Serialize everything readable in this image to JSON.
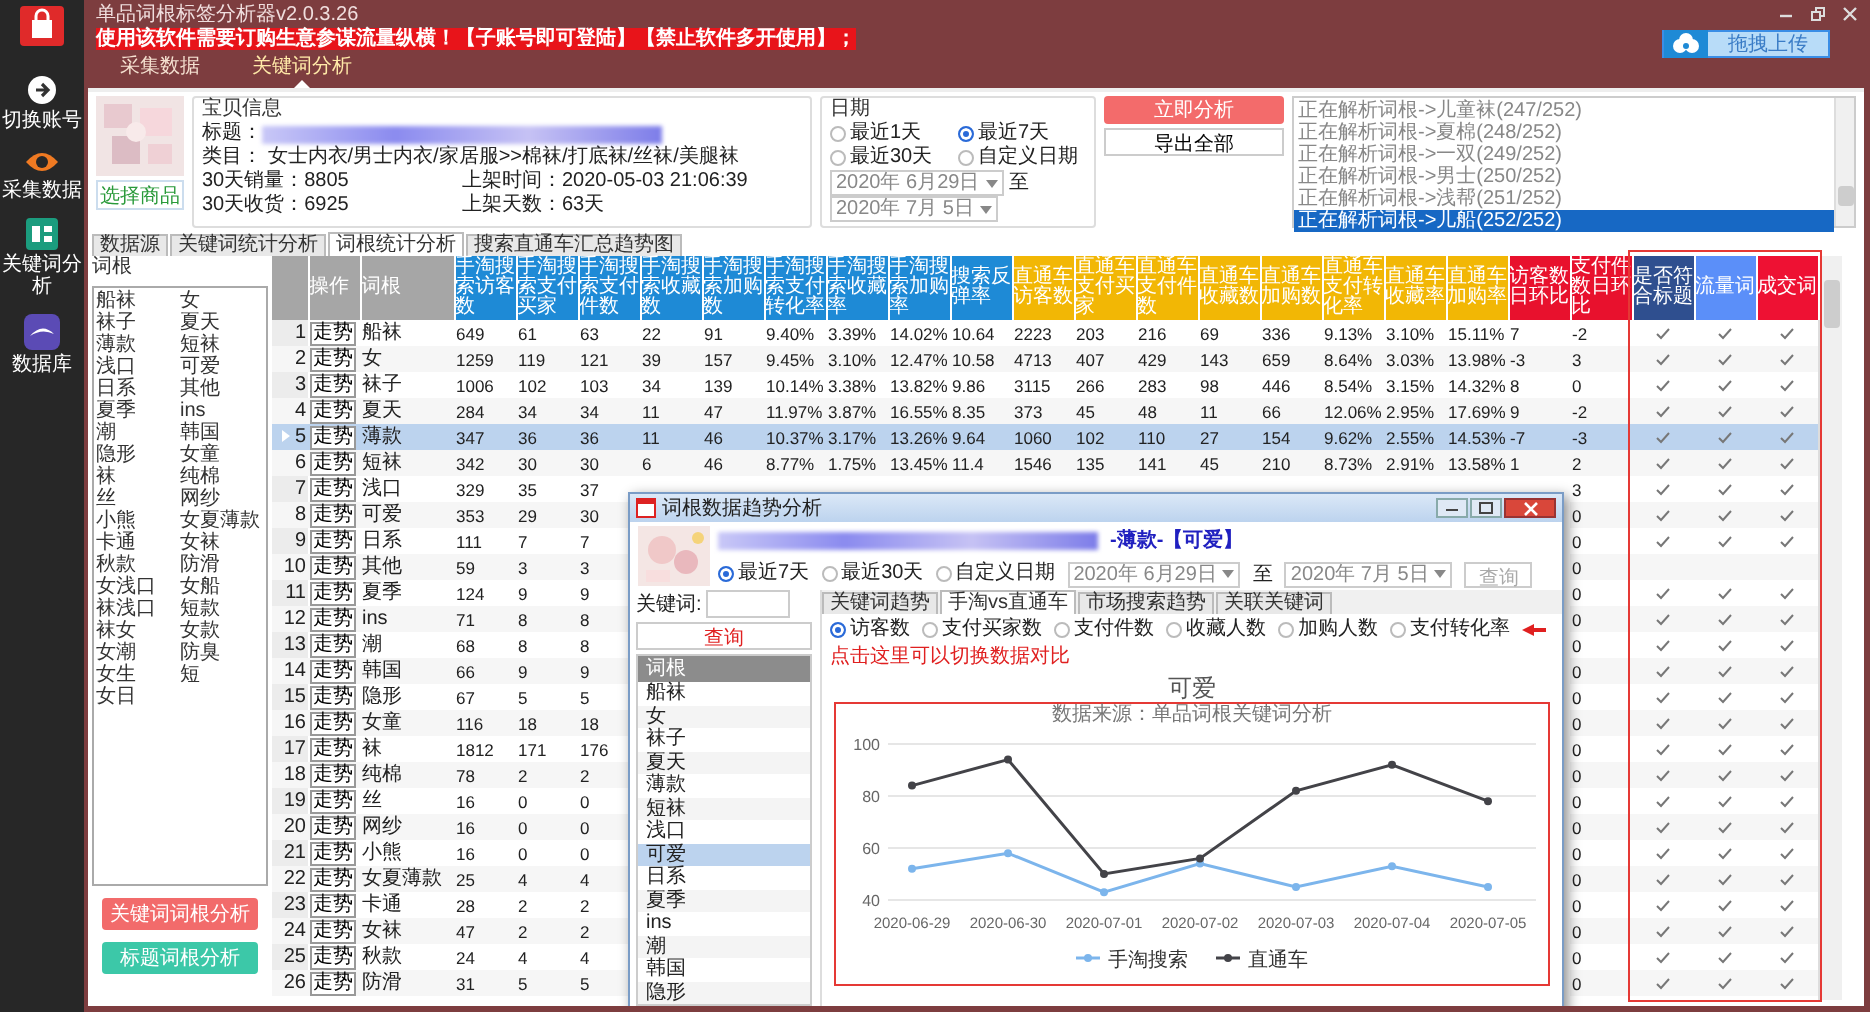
{
  "sidebar": {
    "items": [
      {
        "label": "切换账号",
        "kind": "account"
      },
      {
        "label": "采集数据",
        "kind": "eye"
      },
      {
        "label": "关键词分析",
        "kind": "chart"
      },
      {
        "label": "数据库",
        "kind": "database"
      }
    ]
  },
  "app": {
    "title": "单品词根标签分析器v2.0.3.26",
    "notice": "使用该软件需要订购生意参谋流量纵横！【子账号即可登陆】【禁止软件多开使用】；",
    "tabs": [
      {
        "label": "采集数据",
        "selected": false
      },
      {
        "label": "关键词分析",
        "selected": true
      }
    ],
    "upload_button": "拖拽上传"
  },
  "product": {
    "select_button": "选择商品",
    "group_title": "宝贝信息",
    "title_label": "标题：",
    "category": "类目：  女士内衣/男士内衣/家居服>>棉袜/打底袜/丝袜/美腿袜",
    "sales": "30天销量：8805",
    "received": "30天收货：6925",
    "listed": "上架时间：2020-05-03 21:06:39",
    "days": "上架天数：63天"
  },
  "date_filter": {
    "title": "日期",
    "options": [
      {
        "label": "最近1天",
        "selected": false
      },
      {
        "label": "最近7天",
        "selected": true
      },
      {
        "label": "最近30天",
        "selected": false
      },
      {
        "label": "自定义日期",
        "selected": false
      }
    ],
    "from": "2020年 6月29日",
    "separator": "至",
    "to": "2020年 7月 5日"
  },
  "actions": {
    "analyze": "立即分析",
    "export": "导出全部"
  },
  "log": [
    {
      "text": "正在解析词根->儿童袜(247/252)",
      "selected": false
    },
    {
      "text": "正在解析词根->夏棉(248/252)",
      "selected": false
    },
    {
      "text": "正在解析词根->一双(249/252)",
      "selected": false
    },
    {
      "text": "正在解析词根->男士(250/252)",
      "selected": false
    },
    {
      "text": "正在解析词根->浅帮(251/252)",
      "selected": false
    },
    {
      "text": "正在解析词根->儿船(252/252)",
      "selected": true
    }
  ],
  "subtabs": [
    {
      "label": "数据源",
      "selected": false
    },
    {
      "label": "关键词统计分析",
      "selected": false
    },
    {
      "label": "词根统计分析",
      "selected": true
    },
    {
      "label": "搜索直通车汇总趋势图",
      "selected": false
    }
  ],
  "roots": {
    "title": "词根",
    "items": [
      "船袜",
      "女",
      "袜子",
      "夏天",
      "薄款",
      "短袜",
      "浅口",
      "可爱",
      "日系",
      "其他",
      "夏季",
      "ins",
      "潮",
      "韩国",
      "隐形",
      "女童",
      "袜",
      "纯棉",
      "丝",
      "网纱",
      "小熊",
      "女夏薄款",
      "卡通",
      "女袜",
      "秋款",
      "防滑",
      "女浅口",
      "女船",
      "袜浅口",
      "短款",
      "袜女",
      "女款",
      "女潮",
      "防臭",
      "女生",
      "短",
      "女日"
    ],
    "buttons": [
      {
        "label": "关键词词根分析",
        "color": "#f26b6b"
      },
      {
        "label": "标题词根分析",
        "color": "#3cc8a8"
      }
    ]
  },
  "table": {
    "columns": [
      {
        "label": "操作",
        "color": "#a6a6a6"
      },
      {
        "label": "词根",
        "color": "#a6a6a6"
      },
      {
        "label": "手淘搜索访客数",
        "color": "#1e8ad6"
      },
      {
        "label": "手淘搜索支付买家",
        "color": "#1e8ad6"
      },
      {
        "label": "手淘搜索支付件数",
        "color": "#1e8ad6"
      },
      {
        "label": "手淘搜索收藏数",
        "color": "#1e8ad6"
      },
      {
        "label": "手淘搜索加购数",
        "color": "#1e8ad6"
      },
      {
        "label": "手淘搜索支付转化率",
        "color": "#1e8ad6"
      },
      {
        "label": "手淘搜索收藏率",
        "color": "#1e8ad6"
      },
      {
        "label": "手淘搜索加购率",
        "color": "#1e8ad6"
      },
      {
        "label": "搜索反弹率",
        "color": "#1e8ad6"
      },
      {
        "label": "直通车访客数",
        "color": "#f2b705"
      },
      {
        "label": "直通车支付买家",
        "color": "#f2b705"
      },
      {
        "label": "直通车支付件数",
        "color": "#f2b705"
      },
      {
        "label": "直通车收藏数",
        "color": "#f2b705"
      },
      {
        "label": "直通车加购数",
        "color": "#f2b705"
      },
      {
        "label": "直通车支付转化率",
        "color": "#f2b705"
      },
      {
        "label": "直通车收藏率",
        "color": "#f2b705"
      },
      {
        "label": "直通车加购率",
        "color": "#f2b705"
      },
      {
        "label": "访客数日环比",
        "color": "#e8112d"
      },
      {
        "label": "支付件数日环比",
        "color": "#e8112d"
      },
      {
        "label": "是否符合标题",
        "color": "#2f4f8f"
      },
      {
        "label": "流量词",
        "color": "#5b8ff9"
      },
      {
        "label": "成交词",
        "color": "#ee1133"
      }
    ],
    "rows": [
      {
        "index": "1",
        "action": "走势",
        "root": "船袜",
        "selected": false,
        "values": [
          "649",
          "61",
          "63",
          "22",
          "91",
          "9.40%",
          "3.39%",
          "14.02%",
          "10.64",
          "2223",
          "203",
          "216",
          "69",
          "336",
          "9.13%",
          "3.10%",
          "15.11%",
          "7",
          "-2"
        ],
        "checks": [
          {
            "checked": true
          },
          {
            "checked": true
          },
          {
            "checked": true
          }
        ]
      },
      {
        "index": "2",
        "action": "走势",
        "root": "女",
        "selected": false,
        "values": [
          "1259",
          "119",
          "121",
          "39",
          "157",
          "9.45%",
          "3.10%",
          "12.47%",
          "10.58",
          "4713",
          "407",
          "429",
          "143",
          "659",
          "8.64%",
          "3.03%",
          "13.98%",
          "-3",
          "3"
        ],
        "checks": [
          {
            "checked": true
          },
          {
            "checked": true
          },
          {
            "checked": true
          }
        ]
      },
      {
        "index": "3",
        "action": "走势",
        "root": "袜子",
        "selected": false,
        "values": [
          "1006",
          "102",
          "103",
          "34",
          "139",
          "10.14%",
          "3.38%",
          "13.82%",
          "9.86",
          "3115",
          "266",
          "283",
          "98",
          "446",
          "8.54%",
          "3.15%",
          "14.32%",
          "8",
          "0"
        ],
        "checks": [
          {
            "checked": true
          },
          {
            "checked": true
          },
          {
            "checked": true
          }
        ]
      },
      {
        "index": "4",
        "action": "走势",
        "root": "夏天",
        "selected": false,
        "values": [
          "284",
          "34",
          "34",
          "11",
          "47",
          "11.97%",
          "3.87%",
          "16.55%",
          "8.35",
          "373",
          "45",
          "48",
          "11",
          "66",
          "12.06%",
          "2.95%",
          "17.69%",
          "9",
          "-2"
        ],
        "checks": [
          {
            "checked": true
          },
          {
            "checked": true
          },
          {
            "checked": true
          }
        ]
      },
      {
        "index": "5",
        "action": "走势",
        "root": "薄款",
        "selected": true,
        "values": [
          "347",
          "36",
          "36",
          "11",
          "46",
          "10.37%",
          "3.17%",
          "13.26%",
          "9.64",
          "1060",
          "102",
          "110",
          "27",
          "154",
          "9.62%",
          "2.55%",
          "14.53%",
          "-7",
          "-3"
        ],
        "checks": [
          {
            "checked": true
          },
          {
            "checked": true
          },
          {
            "checked": true
          }
        ]
      },
      {
        "index": "6",
        "action": "走势",
        "root": "短袜",
        "selected": false,
        "values": [
          "342",
          "30",
          "30",
          "6",
          "46",
          "8.77%",
          "1.75%",
          "13.45%",
          "11.4",
          "1546",
          "135",
          "141",
          "45",
          "210",
          "8.73%",
          "2.91%",
          "13.58%",
          "1",
          "2"
        ],
        "checks": [
          {
            "checked": true
          },
          {
            "checked": true
          },
          {
            "checked": true
          }
        ]
      },
      {
        "index": "7",
        "action": "走势",
        "root": "浅口",
        "selected": false,
        "values": [
          "329",
          "35",
          "37"
        ],
        "last_value": "3",
        "checks": [
          {
            "checked": true
          },
          {
            "checked": true
          },
          {
            "checked": true
          }
        ]
      },
      {
        "index": "8",
        "action": "走势",
        "root": "可爱",
        "selected": false,
        "values": [
          "353",
          "29",
          "30"
        ],
        "last_value": "0",
        "checks": [
          {
            "checked": true
          },
          {
            "checked": true
          },
          {
            "checked": true
          }
        ]
      },
      {
        "index": "9",
        "action": "走势",
        "root": "日系",
        "selected": false,
        "values": [
          "111",
          "7",
          "7"
        ],
        "last_value": "0",
        "checks": [
          {
            "checked": true
          },
          {
            "checked": true
          },
          {
            "checked": true
          }
        ]
      },
      {
        "index": "10",
        "action": "走势",
        "root": "其他",
        "selected": false,
        "values": [
          "59",
          "3",
          "3"
        ],
        "last_value": "0",
        "checks": [
          {
            "checked": false
          },
          {
            "checked": false
          },
          {
            "checked": false
          }
        ]
      },
      {
        "index": "11",
        "action": "走势",
        "root": "夏季",
        "selected": false,
        "values": [
          "124",
          "9",
          "9"
        ],
        "last_value": "0",
        "checks": [
          {
            "checked": true
          },
          {
            "checked": true
          },
          {
            "checked": true
          }
        ]
      },
      {
        "index": "12",
        "action": "走势",
        "root": "ins",
        "selected": false,
        "values": [
          "71",
          "8",
          "8"
        ],
        "last_value": "0",
        "checks": [
          {
            "checked": true
          },
          {
            "checked": true
          },
          {
            "checked": true
          }
        ]
      },
      {
        "index": "13",
        "action": "走势",
        "root": "潮",
        "selected": false,
        "values": [
          "68",
          "8",
          "8"
        ],
        "last_value": "0",
        "checks": [
          {
            "checked": true
          },
          {
            "checked": true
          },
          {
            "checked": true
          }
        ]
      },
      {
        "index": "14",
        "action": "走势",
        "root": "韩国",
        "selected": false,
        "values": [
          "66",
          "9",
          "9"
        ],
        "last_value": "0",
        "checks": [
          {
            "checked": true
          },
          {
            "checked": true
          },
          {
            "checked": true
          }
        ]
      },
      {
        "index": "15",
        "action": "走势",
        "root": "隐形",
        "selected": false,
        "values": [
          "67",
          "5",
          "5"
        ],
        "last_value": "0",
        "checks": [
          {
            "checked": true
          },
          {
            "checked": true
          },
          {
            "checked": true
          }
        ]
      },
      {
        "index": "16",
        "action": "走势",
        "root": "女童",
        "selected": false,
        "values": [
          "116",
          "18",
          "18"
        ],
        "last_value": "0",
        "checks": [
          {
            "checked": true
          },
          {
            "checked": true
          },
          {
            "checked": true
          }
        ]
      },
      {
        "index": "17",
        "action": "走势",
        "root": "袜",
        "selected": false,
        "values": [
          "1812",
          "171",
          "176"
        ],
        "last_value": "0",
        "checks": [
          {
            "checked": true
          },
          {
            "checked": true
          },
          {
            "checked": true
          }
        ]
      },
      {
        "index": "18",
        "action": "走势",
        "root": "纯棉",
        "selected": false,
        "values": [
          "78",
          "2",
          "2"
        ],
        "last_value": "0",
        "checks": [
          {
            "checked": true
          },
          {
            "checked": true
          },
          {
            "checked": true
          }
        ]
      },
      {
        "index": "19",
        "action": "走势",
        "root": "丝",
        "selected": false,
        "values": [
          "16",
          "0",
          "0"
        ],
        "last_value": "0",
        "checks": [
          {
            "checked": true
          },
          {
            "checked": true
          },
          {
            "checked": true
          }
        ]
      },
      {
        "index": "20",
        "action": "走势",
        "root": "网纱",
        "selected": false,
        "values": [
          "16",
          "0",
          "0"
        ],
        "last_value": "0",
        "checks": [
          {
            "checked": true
          },
          {
            "checked": true
          },
          {
            "checked": true
          }
        ]
      },
      {
        "index": "21",
        "action": "走势",
        "root": "小熊",
        "selected": false,
        "values": [
          "16",
          "0",
          "0"
        ],
        "last_value": "0",
        "checks": [
          {
            "checked": true
          },
          {
            "checked": true
          },
          {
            "checked": true
          }
        ]
      },
      {
        "index": "22",
        "action": "走势",
        "root": "女夏薄款",
        "selected": false,
        "values": [
          "25",
          "4",
          "4"
        ],
        "last_value": "0",
        "checks": [
          {
            "checked": true
          },
          {
            "checked": true
          },
          {
            "checked": true
          }
        ]
      },
      {
        "index": "23",
        "action": "走势",
        "root": "卡通",
        "selected": false,
        "values": [
          "28",
          "2",
          "2"
        ],
        "last_value": "0",
        "checks": [
          {
            "checked": true
          },
          {
            "checked": true
          },
          {
            "checked": true
          }
        ]
      },
      {
        "index": "24",
        "action": "走势",
        "root": "女袜",
        "selected": false,
        "values": [
          "47",
          "2",
          "2"
        ],
        "last_value": "0",
        "checks": [
          {
            "checked": true
          },
          {
            "checked": true
          },
          {
            "checked": true
          }
        ]
      },
      {
        "index": "25",
        "action": "走势",
        "root": "秋款",
        "selected": false,
        "values": [
          "24",
          "4",
          "4"
        ],
        "last_value": "0",
        "checks": [
          {
            "checked": true
          },
          {
            "checked": true
          },
          {
            "checked": true
          }
        ]
      },
      {
        "index": "26",
        "action": "走势",
        "root": "防滑",
        "selected": false,
        "values": [
          "31",
          "5",
          "5"
        ],
        "last_value": "0",
        "checks": [
          {
            "checked": true
          },
          {
            "checked": true
          },
          {
            "checked": true
          }
        ]
      }
    ]
  },
  "dialog": {
    "title": "词根数据趋势分析",
    "heading": "-薄款-【可爱】",
    "ranges": [
      {
        "label": "最近7天",
        "selected": true
      },
      {
        "label": "最近30天",
        "selected": false
      },
      {
        "label": "自定义日期",
        "selected": false
      }
    ],
    "from": "2020年 6月29日",
    "separator": "至",
    "to": "2020年 7月 5日",
    "query_button": {
      "label": "查询",
      "disabled": true
    },
    "keyword_label": "关键词:",
    "search_button": "查询",
    "list_header": "词根",
    "list": [
      {
        "label": "船袜",
        "selected": false
      },
      {
        "label": "女",
        "selected": false
      },
      {
        "label": "袜子",
        "selected": false
      },
      {
        "label": "夏天",
        "selected": false
      },
      {
        "label": "薄款",
        "selected": false
      },
      {
        "label": "短袜",
        "selected": false
      },
      {
        "label": "浅口",
        "selected": false
      },
      {
        "label": "可爱",
        "selected": true
      },
      {
        "label": "日系",
        "selected": false
      },
      {
        "label": "夏季",
        "selected": false
      },
      {
        "label": "ins",
        "selected": false
      },
      {
        "label": "潮",
        "selected": false
      },
      {
        "label": "韩国",
        "selected": false
      },
      {
        "label": "隐形",
        "selected": false
      }
    ],
    "tabs": [
      {
        "label": "关键词趋势",
        "selected": false
      },
      {
        "label": "手淘vs直通车",
        "selected": true
      },
      {
        "label": "市场搜索趋势",
        "selected": false
      },
      {
        "label": "关联关键词",
        "selected": false
      }
    ],
    "metrics": [
      {
        "label": "访客数",
        "selected": true
      },
      {
        "label": "支付买家数",
        "selected": false
      },
      {
        "label": "支付件数",
        "selected": false
      },
      {
        "label": "收藏人数",
        "selected": false
      },
      {
        "label": "加购人数",
        "selected": false
      },
      {
        "label": "支付转化率",
        "selected": false
      }
    ],
    "hint": "点击这里可以切换数据对比",
    "chart_subtitle": "数据来源：单品词根关键词分析",
    "chart_data": {
      "type": "line",
      "title": "可爱",
      "categories": [
        "2020-06-29",
        "2020-06-30",
        "2020-07-01",
        "2020-07-02",
        "2020-07-03",
        "2020-07-04",
        "2020-07-05"
      ],
      "series": [
        {
          "name": "手淘搜索",
          "color": "#7cb5ec",
          "marker": "circle",
          "values": [
            52,
            58,
            43,
            54,
            45,
            53,
            45
          ]
        },
        {
          "name": "直通车",
          "color": "#434348",
          "marker": "circle",
          "values": [
            84,
            94,
            50,
            56,
            82,
            92,
            78
          ]
        }
      ],
      "ylim": [
        40,
        100
      ],
      "yticks": [
        40,
        60,
        80,
        100
      ],
      "legend": "bottom"
    }
  }
}
